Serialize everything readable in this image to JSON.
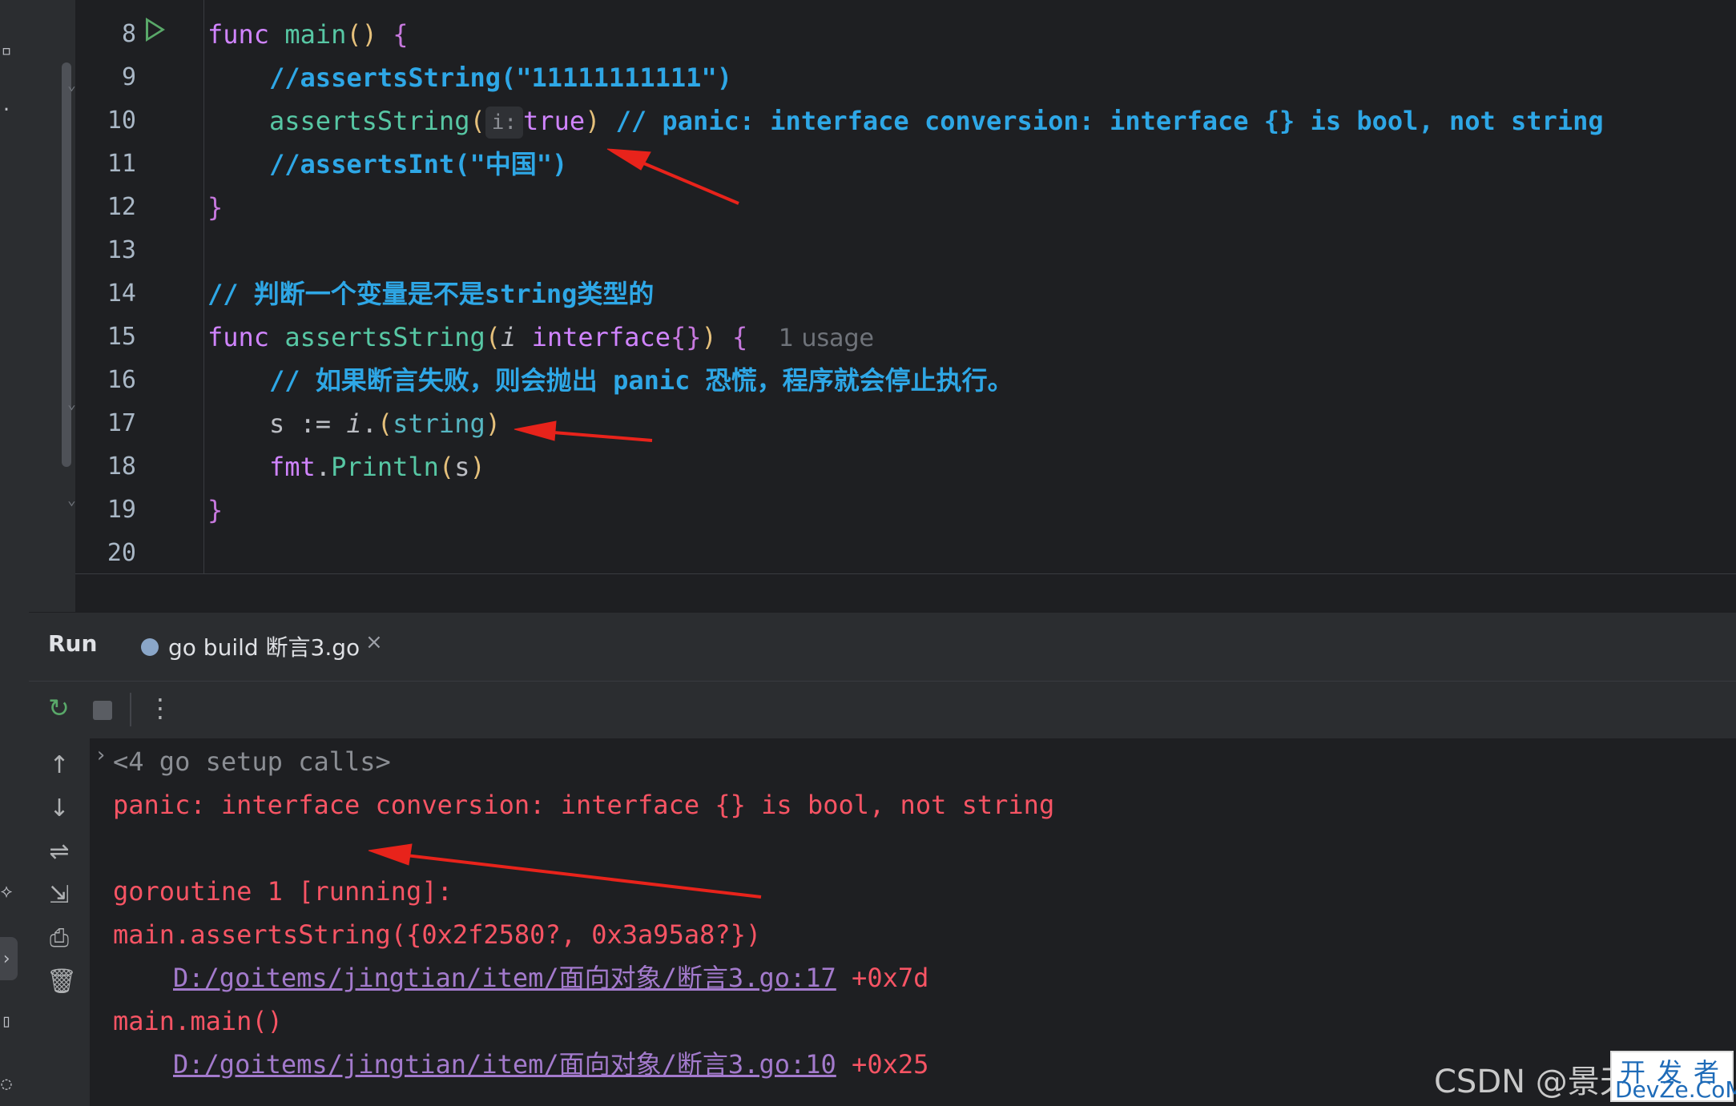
{
  "editor": {
    "lines": [
      {
        "num": "8"
      },
      {
        "num": "9"
      },
      {
        "num": "10"
      },
      {
        "num": "11"
      },
      {
        "num": "12"
      },
      {
        "num": "13"
      },
      {
        "num": "14"
      },
      {
        "num": "15"
      },
      {
        "num": "16"
      },
      {
        "num": "17"
      },
      {
        "num": "18"
      },
      {
        "num": "19"
      },
      {
        "num": "20"
      }
    ],
    "code": {
      "l8_func": "func ",
      "l8_name": "main",
      "l8_paren": "()",
      "l8_brace": " {",
      "l9": "//assertsString(\"11111111111\")",
      "l10_call": "assertsString",
      "l10_open": "(",
      "l10_hint": "i:",
      "l10_arg": "true",
      "l10_close": ")",
      "l10_comment": " // panic: interface conversion: interface {} is bool, not string",
      "l11": "//assertsInt(\"中国\")",
      "l12": "}",
      "l14": "// 判断一个变量是不是string类型的",
      "l15_func": "func ",
      "l15_name": "assertsString",
      "l15_open": "(",
      "l15_param": "i",
      "l15_type": " interface",
      "l15_braces": "{}",
      "l15_close": ")",
      "l15_brace": " {",
      "l15_usage": "1 usage",
      "l16": "// 如果断言失败，则会抛出 panic 恐慌，程序就会停止执行。",
      "l17_s": "s := ",
      "l17_i": "i",
      "l17_dot": ".",
      "l17_open": "(",
      "l17_type": "string",
      "l17_close": ")",
      "l18_pkg": "fmt",
      "l18_dot": ".",
      "l18_fn": "Println",
      "l18_open": "(",
      "l18_arg": "s",
      "l18_close": ")",
      "l19": "}"
    }
  },
  "run_panel": {
    "title": "Run",
    "tab_label": "go build 断言3.go",
    "tab_close": "×",
    "toolbar": {
      "rerun_icon": "↻",
      "more_icon": "⋮"
    },
    "side_icons": [
      "↑",
      "↓",
      "⇌",
      "⇲",
      "⎙",
      "🗑"
    ],
    "output": {
      "setup": "<4 go setup calls>",
      "panic": "panic: interface conversion: interface {} is bool, not string",
      "goroutine": "goroutine 1 [running]:",
      "frame1": "main.assertsString({0x2f2580?, 0x3a95a8?})",
      "frame1_path": "D:/goitems/jingtian/item/面向对象/断言3.go:17",
      "frame1_off": " +0x7d",
      "frame2": "main.main()",
      "frame2_path": "D:/goitems/jingtian/item/面向对象/断言3.go:10",
      "frame2_off": " +0x25"
    }
  },
  "watermark": {
    "text": "CSDN @景天",
    "badge_top": "开发者",
    "badge_bottom": "DevZe.CoM"
  },
  "colors": {
    "arrow": "#e8231b",
    "accent": "#3574f0"
  }
}
